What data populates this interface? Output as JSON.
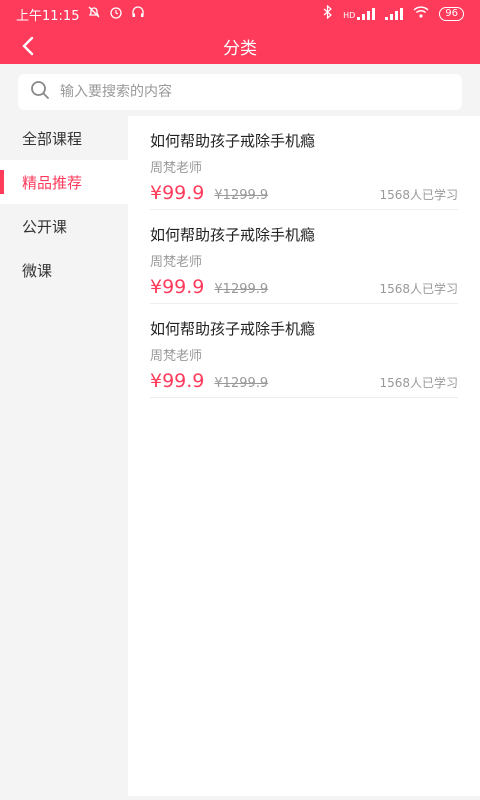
{
  "status": {
    "time": "上午11:15",
    "battery": "96",
    "net_label": "HD"
  },
  "header": {
    "title": "分类"
  },
  "search": {
    "placeholder": "输入要搜索的内容"
  },
  "sidebar": {
    "items": [
      {
        "label": "全部课程"
      },
      {
        "label": "精品推荐"
      },
      {
        "label": "公开课"
      },
      {
        "label": "微课"
      }
    ],
    "active_index": 1
  },
  "courses": [
    {
      "title": "如何帮助孩子戒除手机瘾",
      "teacher": "周梵老师",
      "price": "¥99.9",
      "original_price": "¥1299.9",
      "learners": "1568人已学习"
    },
    {
      "title": "如何帮助孩子戒除手机瘾",
      "teacher": "周梵老师",
      "price": "¥99.9",
      "original_price": "¥1299.9",
      "learners": "1568人已学习"
    },
    {
      "title": "如何帮助孩子戒除手机瘾",
      "teacher": "周梵老师",
      "price": "¥99.9",
      "original_price": "¥1299.9",
      "learners": "1568人已学习"
    }
  ],
  "colors": {
    "accent": "#ff3b5c",
    "background": "#f4f4f4"
  },
  "icons": [
    "back-arrow-icon",
    "search-icon",
    "bluetooth-icon",
    "signal-icon",
    "wifi-icon",
    "battery-icon",
    "alarm-icon",
    "headset-icon",
    "notification-off-icon"
  ]
}
